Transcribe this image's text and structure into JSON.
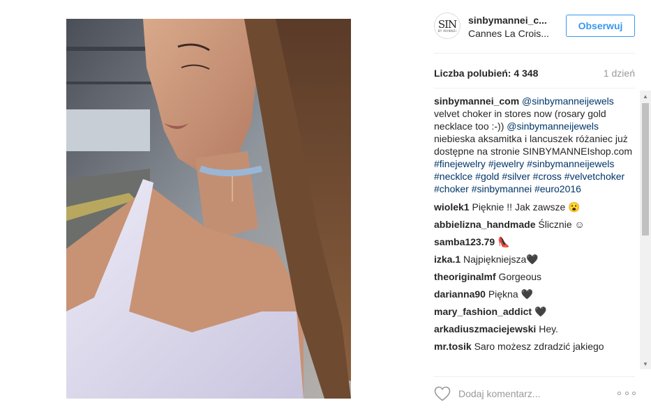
{
  "post": {
    "photo_alt": "",
    "author": {
      "username": "sinbymannei_c...",
      "location": "Cannes La Crois...",
      "avatar_monogram": "SIN",
      "avatar_subtext": "BY MANNEI"
    },
    "follow_label": "Obserwuj",
    "likes": "Liczba polubień: 4 348",
    "time_ago": "1 dzień",
    "caption": {
      "user": "sinbymannei_com",
      "segments": [
        {
          "text": "@sinbymanneijewels",
          "tag": true
        },
        {
          "text": " velvet choker in stores now (rosary gold necklace too :-)) ",
          "tag": false
        },
        {
          "text": "@sinbymanneijewels",
          "tag": true
        },
        {
          "text": " niebieska aksamitka i lancuszek różaniec już dostępne na stronie SINBYMANNEIshop.com ",
          "tag": false
        },
        {
          "text": "#finejewelry",
          "tag": true
        },
        {
          "text": " ",
          "tag": false
        },
        {
          "text": "#jewelry",
          "tag": true
        },
        {
          "text": " ",
          "tag": false
        },
        {
          "text": "#sinbymanneijewels",
          "tag": true
        },
        {
          "text": " ",
          "tag": false
        },
        {
          "text": "#necklce",
          "tag": true
        },
        {
          "text": " ",
          "tag": false
        },
        {
          "text": "#gold",
          "tag": true
        },
        {
          "text": " ",
          "tag": false
        },
        {
          "text": "#silver",
          "tag": true
        },
        {
          "text": " ",
          "tag": false
        },
        {
          "text": "#cross",
          "tag": true
        },
        {
          "text": " ",
          "tag": false
        },
        {
          "text": "#velvetchoker",
          "tag": true
        },
        {
          "text": " ",
          "tag": false
        },
        {
          "text": "#choker",
          "tag": true
        },
        {
          "text": " ",
          "tag": false
        },
        {
          "text": "#sinbymannei",
          "tag": true
        },
        {
          "text": " ",
          "tag": false
        },
        {
          "text": "#euro2016",
          "tag": true
        }
      ]
    },
    "comments": [
      {
        "user": "wiolek1",
        "text": "Pięknie !! Jak zawsze 😮"
      },
      {
        "user": "abbielizna_handmade",
        "text": "Ślicznie ☺"
      },
      {
        "user": "samba123.79",
        "text": "👠"
      },
      {
        "user": "izka.1",
        "text": "Najpiękniejsza🖤"
      },
      {
        "user": "theoriginalmf",
        "text": "Gorgeous"
      },
      {
        "user": "darianna90",
        "text": "Piękna 🖤"
      },
      {
        "user": "mary_fashion_addict",
        "text": "🖤"
      },
      {
        "user": "arkadiuszmaciejewski",
        "text": "Hey."
      },
      {
        "user": "mr.tosik",
        "text": "Saro możesz zdradzić jakiego"
      }
    ],
    "add_comment_placeholder": "Dodaj komentarz...",
    "colors": {
      "link": "#003569",
      "accent": "#3897f0",
      "muted": "#999999"
    },
    "icons": {
      "like": "heart-icon",
      "more": "more-options-icon"
    }
  }
}
